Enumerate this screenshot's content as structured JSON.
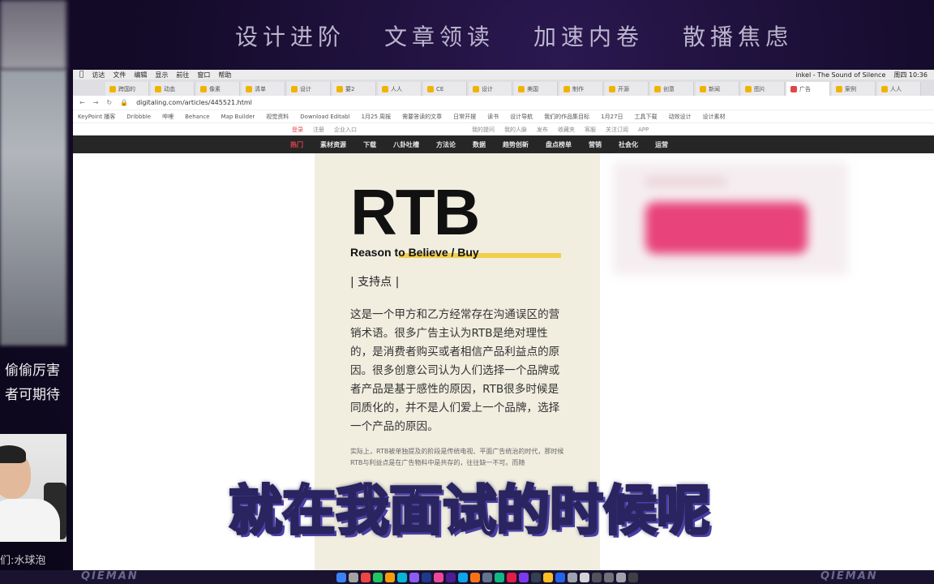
{
  "banner": {
    "items": [
      "设计进阶",
      "文章领读",
      "加速内卷",
      "散播焦虑"
    ]
  },
  "left_panel": {
    "text_lines": [
      "偷偷厉害",
      "者可期待"
    ],
    "streamer_name": "们:水球泡"
  },
  "mac_menubar": {
    "items": [
      "访达",
      "文件",
      "编辑",
      "显示",
      "前往",
      "窗口",
      "帮助"
    ],
    "now_playing": "inkel - The Sound of Silence",
    "clock": "周四 10:36"
  },
  "browser": {
    "tabs": [
      "跨国的",
      "动态",
      "像素",
      "清单",
      "设计",
      "要2",
      "人人",
      "CE",
      "设计",
      "美国",
      "制作",
      "开源",
      "创意",
      "新闻",
      "图片",
      "广告",
      "案例",
      "人人"
    ],
    "url": "digitaling.com/articles/445521.html",
    "bookmarks": [
      "KeyPoint 播客",
      "Dribbble",
      "哔哩",
      "Behance",
      "Map Builder",
      "视觉资料",
      "Download Editabl",
      "1月25 周报",
      "需要答读的文章",
      "日常开摆",
      "读书",
      "设计导航",
      "我们的作品集目标",
      "1月27日",
      "工具下载",
      "动效设计",
      "设计素材"
    ],
    "site_top": [
      "登录",
      "注册",
      "企业入口",
      "我的提问",
      "我的人脉",
      "发布",
      "收藏夹",
      "客服",
      "关注订阅",
      "APP"
    ],
    "site_nav": [
      "热门",
      "素材资源",
      "下载",
      "八卦吐槽",
      "方法论",
      "数据",
      "趋势创新",
      "盘点榜单",
      "营销",
      "社会化",
      "运营"
    ]
  },
  "article": {
    "title": "RTB",
    "subtitle": "Reason to Believe / Buy",
    "section_label": "| 支持点 |",
    "paragraph": "这是一个甲方和乙方经常存在沟通误区的营销术语。很多广告主认为RTB是绝对理性的，是消费者购买或者相信产品利益点的原因。很多创意公司认为人们选择一个品牌或者产品是基于感性的原因，RTB很多时候是同质化的，并不是人们爱上一个品牌，选择一个产品的原因。",
    "small_text": "实际上，RTB被单独提及的阶段是传统电视、平面广告统治的时代，那时候RTB与利益点是在广告物料中是共存的，往往缺一不可。而随"
  },
  "watermark": "QIEMAN",
  "subtitle_caption": "就在我面试的时候呢",
  "colors": {
    "accent_yellow": "#f0cf4c",
    "nav_dark": "#262626",
    "hot_red": "#e1454b"
  }
}
